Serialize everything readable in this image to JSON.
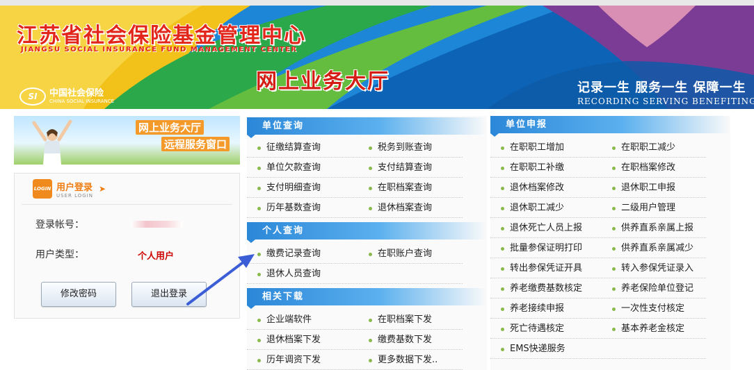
{
  "banner": {
    "title": "江苏省社会保险基金管理中心",
    "subtitle": "JIANGSU SOCIAL INSURANCE FUND MANAGEMENT CENTER",
    "hall": "网上业务大厅",
    "logo_cn": "中国社会保险",
    "logo_en": "CHINA SOCIAL INSURANCE",
    "logo_mark": "SI",
    "slogan": "记录一生  服务一生  保障一生",
    "slogan_en": "RECORDING   SERVING   BENEFITING"
  },
  "promo": {
    "line1": "网上业务大厅",
    "line2": "远程服务窗口"
  },
  "login": {
    "icon_text": "LOGIN",
    "title": "用户登录",
    "title_en": "USER LOGIN",
    "account_label": "登录帐号：",
    "type_label": "用户类型：",
    "type_value": "个人用户",
    "change_password": "修改密码",
    "logout": "退出登录"
  },
  "sections": {
    "unit_query": {
      "title": "单位查询",
      "rows": [
        [
          "征缴结算查询",
          "税务到账查询"
        ],
        [
          "单位欠款查询",
          "支付结算查询"
        ],
        [
          "支付明细查询",
          "在职档案查询"
        ],
        [
          "历年基数查询",
          "退休档案查询"
        ]
      ]
    },
    "personal_query": {
      "title": "个人查询",
      "rows": [
        [
          "缴费记录查询",
          "在职账户查询"
        ],
        [
          "退休人员查询",
          ""
        ]
      ]
    },
    "downloads": {
      "title": "相关下载",
      "rows": [
        [
          "企业端软件",
          "在职档案下发"
        ],
        [
          "退休档案下发",
          "缴费基数下发"
        ],
        [
          "历年调资下发",
          "更多数据下发.."
        ]
      ]
    },
    "unit_report": {
      "title": "单位申报",
      "rows": [
        [
          "在职职工增加",
          "在职职工减少"
        ],
        [
          "在职职工补缴",
          "在职档案修改"
        ],
        [
          "退休档案修改",
          "退休职工申报"
        ],
        [
          "退休职工减少",
          "二级用户管理"
        ],
        [
          "退休死亡人员上报",
          "供养直系亲属上报"
        ],
        [
          "批量参保证明打印",
          "供养直系亲属减少"
        ],
        [
          "转出参保凭证开具",
          "转入参保凭证录入"
        ],
        [
          "养老缴费基数核定",
          "养老保险单位登记"
        ],
        [
          "养老接续申报",
          "一次性支付核定"
        ],
        [
          "死亡待遇核定",
          "基本养老金核定"
        ],
        [
          "EMS快递服务",
          ""
        ]
      ]
    }
  },
  "colors": {
    "accent_blue": "#2b87d8",
    "title_red": "#e2261b",
    "login_orange": "#ef7d10",
    "user_type_red": "#cc0000",
    "bullet_green": "#8ab84a"
  }
}
